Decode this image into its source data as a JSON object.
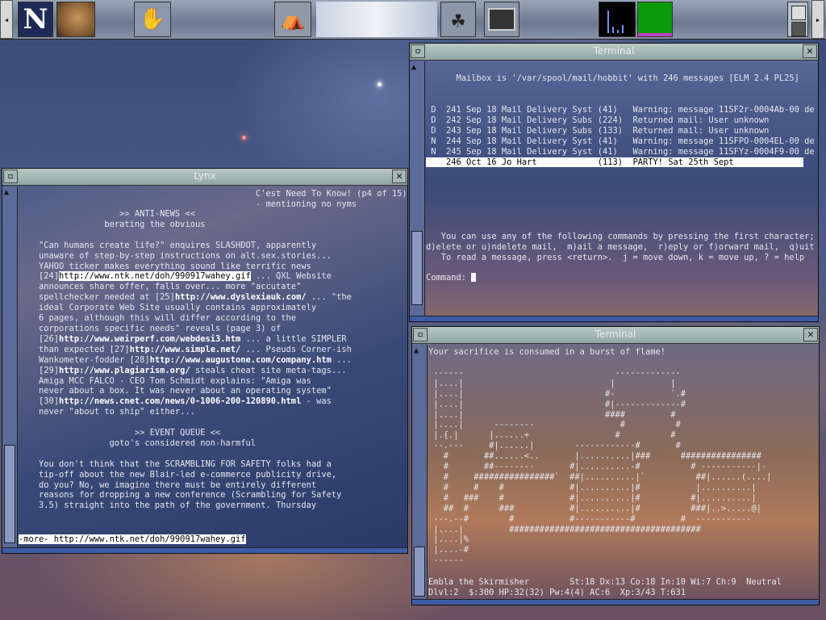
{
  "panel": {
    "left_arrow": "◂",
    "right_arrow": "▸",
    "netscape_letter": "N",
    "icons": [
      "netscape-icon",
      "cougar-icon",
      "gimp-foot-icon",
      "toolbox-icon",
      "gnome-foot-icon",
      "monitor-icon"
    ]
  },
  "mutt_window": {
    "title": "Lynx",
    "header_right": [
      "C'est Need To Know! (p4 of 15)",
      "- mentioning no nyms"
    ],
    "status_line": "-more- http://www.ntk.net/doh/990917wahey.gif",
    "lines": [
      {
        "t": "",
        "pre": "",
        "hl": "",
        "post": ""
      },
      {
        "t": "                    >> ANTI-NEWS <<"
      },
      {
        "t": "                 berating the obvious"
      },
      {
        "t": ""
      },
      {
        "t": "    \"Can humans create life?\" enquires SLASHDOT, apparently"
      },
      {
        "t": "    unaware of step-by-step instructions on alt.sex.stories..."
      },
      {
        "t": "    YAHOO ticker makes everything sound like terrific news"
      },
      {
        "pre": "    [24]",
        "hl": "http://www.ntk.net/doh/990917wahey.gif",
        "post": " ... QXL Website"
      },
      {
        "t": "    announces share offer, falls over... more \"accutate\""
      },
      {
        "pre": "    spellchecker needed at [25]",
        "u": "http://www.dyslexiauk.com/",
        "post": " ... \"the"
      },
      {
        "t": "    ideal Corporate Web Site usually contains approximately"
      },
      {
        "t": "    6 pages, although this will differ according to the"
      },
      {
        "t": "    corporations specific needs\" reveals (page 3) of"
      },
      {
        "pre": "    [26]",
        "u": "http://www.weirperf.com/webdesi3.htm",
        "post": " ... a little SIMPLER"
      },
      {
        "pre": "    than expected [27]",
        "u": "http://www.simple.net/",
        "post": " ... Pseuds Corner-ish"
      },
      {
        "pre": "    Wankometer-fodder [28]",
        "u": "http://www.augustone.com/company.htm",
        "post": " ..."
      },
      {
        "pre": "    [29]",
        "u": "http://www.plagiarism.org/",
        "post": " steals cheat site meta-tags..."
      },
      {
        "t": "    Amiga MCC FALCO - CEO Tom Schmidt explains: \"Amiga was"
      },
      {
        "t": "    never about a box. It was never about an operating system\""
      },
      {
        "pre": "    [30]",
        "u": "http://news.cnet.com/news/0-1006-200-120890.html",
        "post": " - was"
      },
      {
        "t": "    never \"about to ship\" either..."
      },
      {
        "t": ""
      },
      {
        "t": "                       >> EVENT QUEUE <<"
      },
      {
        "t": "                  goto's considered non-harmful"
      },
      {
        "t": ""
      },
      {
        "t": "    You don't think that the SCRAMBLING FOR SAFETY folks had a"
      },
      {
        "t": "    tip-off about the new Blair-led e-commerce publicity drive,"
      },
      {
        "t": "    do you? No, we imagine there must be entirely different"
      },
      {
        "t": "    reasons for dropping a new conference (Scrambling for Safety"
      },
      {
        "t": "    3.5) straight into the path of the government. Thursday"
      }
    ]
  },
  "elm_window": {
    "title": "Terminal",
    "header": "      Mailbox is '/var/spool/mail/hobbit' with 246 messages [ELM 2.4 PL25]",
    "messages": [
      " D  241 Sep 18 Mail Delivery Syst (41)   Warning: message 11SF2r-0004Ab-00 de",
      " D  242 Sep 18 Mail Delivery Subs (224)  Returned mail: User unknown",
      " D  243 Sep 18 Mail Delivery Subs (133)  Returned mail: User unknown",
      " N  244 Sep 18 Mail Delivery Syst (41)   Warning: message 11SFPO-0004EL-00 de",
      " N  245 Sep 18 Mail Delivery Syst (41)   Warning: message 11SFYz-0004F9-00 de",
      "    246 Oct 16 Jo Hart            (113)  PARTY! Sat 25th Sept"
    ],
    "help_lines": [
      "   You can use any of the following commands by pressing the first character;",
      "d)elete or u)ndelete mail,  m)ail a message,  r)eply or f)orward mail,  q)uit",
      "   To read a message, press <return>.  j = move down, k = move up, ? = help"
    ],
    "command_prompt": "Command: "
  },
  "nethack_window": {
    "title": "Terminal",
    "message": "Your sacrifice is consumed in a burst of flame!",
    "map": [
      "",
      " ------                              -------------",
      " |....|                             |           |",
      " |....|                            #-           `.#",
      " |....|                            #|-------------#",
      " |....|                            ####         #",
      " |....|      --------                 #          #",
      " |.{.|      |......+                 #          #",
      " --.---     #|......|        ------------#       #",
      "   #       ##......<..       |..........|###      ################",
      "   #       ##--------       #|..........-#          # -----------|-",
      "   #     ################`  ##|..........|`          ##|......(....|",
      "   #     #    #             #|..........|#           |..........|",
      "   #   ###    #             #|..........|#          #|..........|",
      "   ##  #      ###           #|..........|#          ###|..>.....@|",
      " ---.--#        #           #-----------#         #  -----------",
      " |....|         ######################################",
      " |....|%",
      " |....-#",
      " ------"
    ],
    "status1": "Embla the Skirmisher        St:18 Dx:13 Co:18 In:10 Wi:7 Ch:9  Neutral",
    "status2": "Dlvl:2  $:300 HP:32(32) Pw:4(4) AC:6  Xp:3/43 T:631"
  },
  "colors": {
    "titlebar": "#9fb5b2",
    "scroll": "#5b6b9a",
    "term_text": "#e6e6ee",
    "cpu_bg": "#000000",
    "mem_bg": "#0a9a0a"
  }
}
